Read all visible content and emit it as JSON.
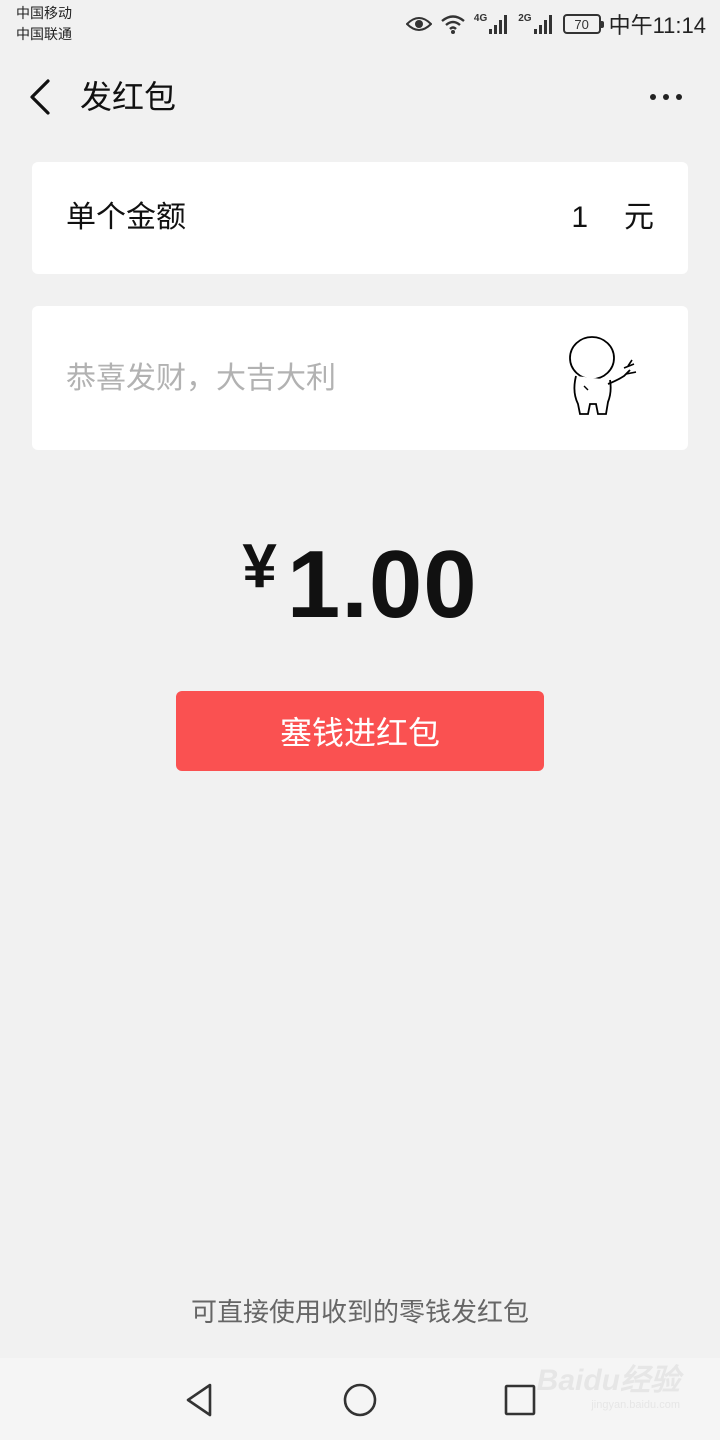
{
  "status_bar": {
    "carrier_1": "中国移动",
    "carrier_2": "中国联通",
    "network_1": "4G",
    "network_2": "2G",
    "battery": "70",
    "time": "中午11:14"
  },
  "nav": {
    "title": "发红包",
    "back_icon": "chevron-left-icon",
    "more_icon": "more-dots-icon"
  },
  "amount": {
    "label": "单个金额",
    "value": "1",
    "unit": "元"
  },
  "greeting": {
    "placeholder": "恭喜发财，大吉大利",
    "value": "",
    "sticker_icon": "sticker-character-icon"
  },
  "total": {
    "currency": "¥",
    "value": "1.00"
  },
  "submit_label": "塞钱进红包",
  "footer_note": "可直接使用收到的零钱发红包",
  "system_nav": {
    "back_icon": "triangle-back-icon",
    "home_icon": "circle-home-icon",
    "recent_icon": "square-recent-icon"
  },
  "watermark": {
    "main": "Baidu经验",
    "sub": "jingyan.baidu.com"
  },
  "colors": {
    "background": "#f1f1f1",
    "card": "#ffffff",
    "accent_red": "#fa5151",
    "placeholder": "#b2b2b2"
  }
}
